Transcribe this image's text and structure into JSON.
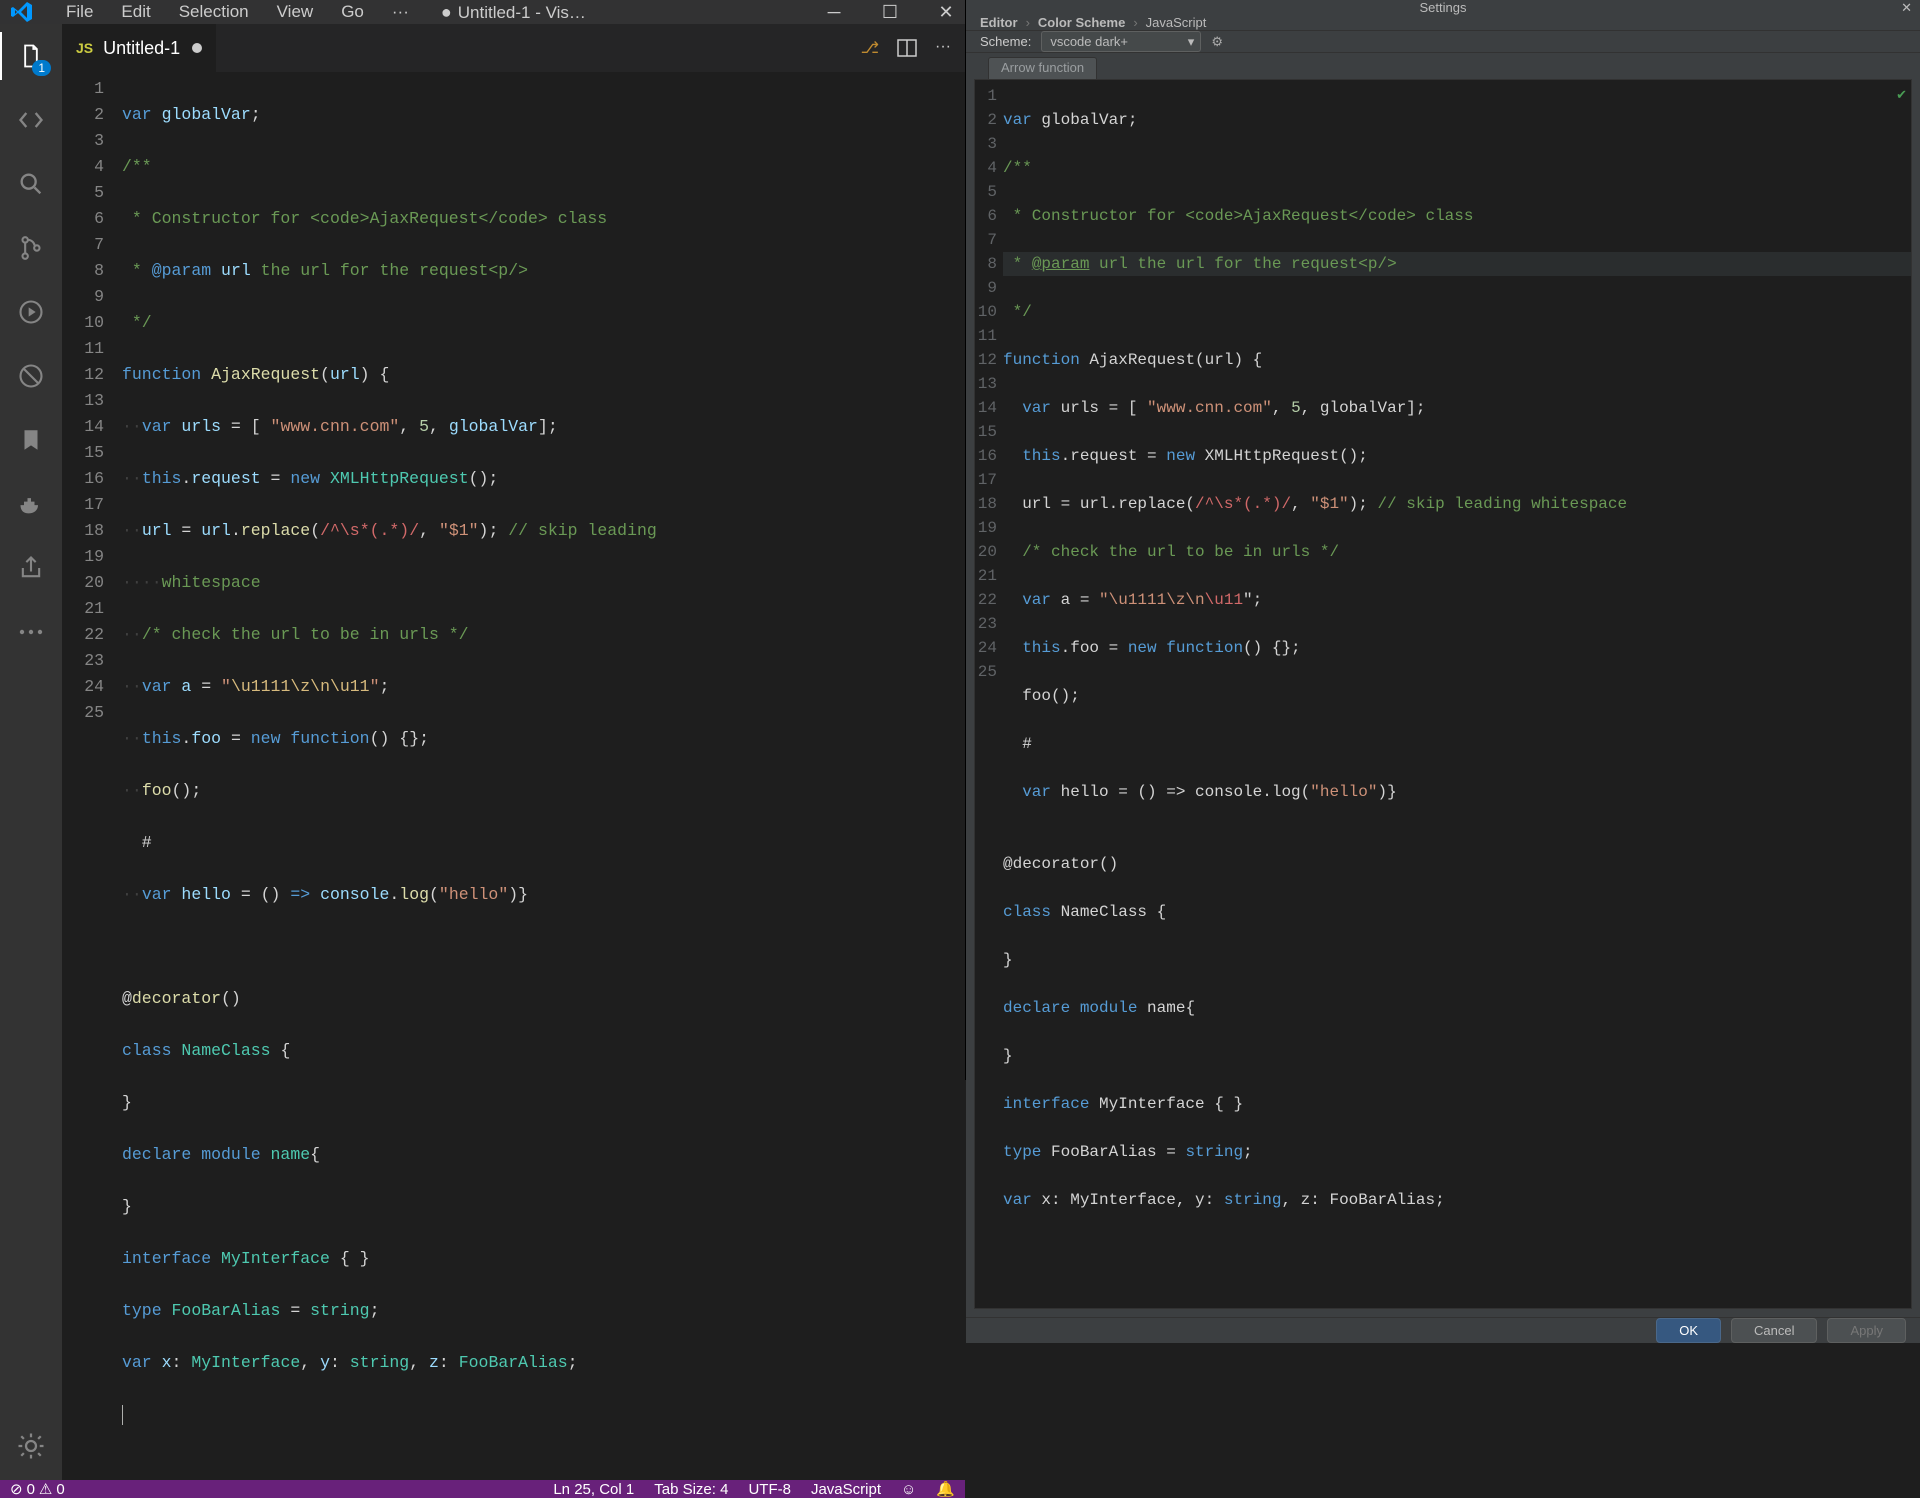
{
  "vscode": {
    "menus": [
      "File",
      "Edit",
      "Selection",
      "View",
      "Go",
      "···"
    ],
    "title_prefix": "●",
    "title": "Untitled-1 - Vis…",
    "tab": {
      "icon": "JS",
      "name": "Untitled-1"
    },
    "activity_badge": "1",
    "gutter": [
      "1",
      "2",
      "3",
      "4",
      "5",
      "6",
      "7",
      "8",
      "9",
      "10",
      "11",
      "12",
      "13",
      "14",
      "15",
      "16",
      "17",
      "18",
      "19",
      "20",
      "21",
      "22",
      "23",
      "24",
      "25"
    ],
    "status": {
      "errors": "0",
      "warnings": "0",
      "cursor": "Ln 25, Col 1",
      "tabsize": "Tab Size: 4",
      "encoding": "UTF-8",
      "language": "JavaScript"
    },
    "code": {
      "l1": {
        "a": "var ",
        "b": "globalVar",
        "c": ";"
      },
      "l2": "/**",
      "l3": {
        "a": " * Constructor for ",
        "b": "<code>",
        "c": "AjaxRequest",
        "d": "</code>",
        "e": " class"
      },
      "l4": {
        "a": " * ",
        "b": "@param",
        "c": " ",
        "d": "url",
        "e": " the url for the request<p/>"
      },
      "l5": " */",
      "l6": {
        "a": "function ",
        "b": "AjaxRequest",
        "c": "(",
        "d": "url",
        "e": ") {"
      },
      "l7": {
        "a": "  ",
        "b": "var ",
        "c": "urls",
        "d": " = [ ",
        "e": "\"www.cnn.com\"",
        "f": ", ",
        "g": "5",
        "h": ", ",
        "i": "globalVar",
        "j": "];"
      },
      "l8": {
        "a": "  ",
        "b": "this",
        "c": ".",
        "d": "request",
        "e": " = ",
        "f": "new ",
        "g": "XMLHttpRequest",
        "h": "();"
      },
      "l9": {
        "a": "  ",
        "b": "url",
        "c": " = ",
        "d": "url",
        "e": ".",
        "f": "replace",
        "g": "(",
        "h": "/^\\s*(.*)/",
        "i": ", ",
        "j": "\"$1\"",
        "k": "); ",
        "l": "// skip leading"
      },
      "l9b": {
        "a": "    ",
        "b": "whitespace"
      },
      "l10": {
        "a": "  ",
        "b": "/* check the url to be in urls */"
      },
      "l11": {
        "a": "  ",
        "b": "var ",
        "c": "a",
        "d": " = ",
        "e": "\"",
        "f": "\\u1111\\z\\n\\u11",
        "g": "\"",
        "h": ";"
      },
      "l12": {
        "a": "  ",
        "b": "this",
        "c": ".",
        "d": "foo",
        "e": " = ",
        "f": "new ",
        "g": "function",
        "h": "() {};"
      },
      "l13": {
        "a": "  ",
        "b": "foo",
        "c": "();"
      },
      "l14": {
        "a": "  #"
      },
      "l15": {
        "a": "  ",
        "b": "var ",
        "c": "hello",
        "d": " = () ",
        "e": "=>",
        "f": " ",
        "g": "console",
        "h": ".",
        "i": "log",
        "j": "(",
        "k": "\"hello\"",
        "l": ")}"
      },
      "l16": "",
      "l17": {
        "a": "@",
        "b": "decorator",
        "c": "()"
      },
      "l18": {
        "a": "class ",
        "b": "NameClass",
        "c": " {"
      },
      "l19": "}",
      "l20": {
        "a": "declare ",
        "b": "module ",
        "c": "name",
        "d": "{"
      },
      "l21": "}",
      "l22": {
        "a": "interface ",
        "b": "MyInterface",
        "c": " { }"
      },
      "l23": {
        "a": "type ",
        "b": "FooBarAlias",
        "c": " = ",
        "d": "string",
        "e": ";"
      },
      "l24": {
        "a": "var ",
        "b": "x",
        "c": ": ",
        "d": "MyInterface",
        "e": ", ",
        "f": "y",
        "g": ": ",
        "h": "string",
        "i": ", ",
        "j": "z",
        "k": ": ",
        "l": "FooBarAlias",
        "m": ";"
      }
    }
  },
  "jetbrains": {
    "title": "Settings",
    "breadcrumb": [
      "Editor",
      "Color Scheme",
      "JavaScript"
    ],
    "scheme_label": "Scheme:",
    "scheme_value": "vscode dark+",
    "tab": "Arrow function",
    "buttons": {
      "ok": "OK",
      "cancel": "Cancel",
      "apply": "Apply"
    },
    "gutter": [
      "1",
      "2",
      "3",
      "4",
      "5",
      "6",
      "7",
      "8",
      "9",
      "10",
      "11",
      "12",
      "13",
      "14",
      "15",
      "16",
      "17",
      "18",
      "19",
      "20",
      "21",
      "22",
      "23",
      "24",
      "25"
    ],
    "code": {
      "l1": {
        "a": "var ",
        "b": "globalVar",
        "c": ";"
      },
      "l2": "/**",
      "l3": " * Constructor for <code>AjaxRequest</code> class",
      "l4": {
        "a": " * ",
        "b": "@param",
        "c": " url the url for the request<p/>"
      },
      "l5": " */",
      "l6": {
        "a": "function ",
        "b": "AjaxRequest",
        "c": "(url) {"
      },
      "l7": {
        "a": "  ",
        "b": "var ",
        "c": "urls = [ ",
        "d": "\"www.cnn.com\"",
        "e": ", ",
        "f": "5",
        "g": ", globalVar];"
      },
      "l8": {
        "a": "  ",
        "b": "this",
        "c": ".request = ",
        "d": "new ",
        "e": "XMLHttpRequest();"
      },
      "l9": {
        "a": "  url = url.replace(",
        "b": "/^\\s*(.*)/",
        "c": ", ",
        "d": "\"$1\"",
        "e": "); ",
        "f": "// skip leading whitespace"
      },
      "l10": {
        "a": "  ",
        "b": "/* check the url to be in urls */"
      },
      "l11": {
        "a": "  ",
        "b": "var ",
        "c": "a = ",
        "d": "\"\\u1111\\z\\n",
        "e": "\\u11",
        "f": "\";"
      },
      "l12": {
        "a": "  ",
        "b": "this",
        "c": ".foo = ",
        "d": "new ",
        "e": "function",
        "f": "() {};"
      },
      "l13": "  foo();",
      "l14": "  #",
      "l15": {
        "a": "  ",
        "b": "var ",
        "c": "hello = () => console.log(",
        "d": "\"hello\"",
        "e": ")}"
      },
      "l16": "",
      "l17": "@decorator()",
      "l18": {
        "a": "class ",
        "b": "NameClass ",
        "c": "{"
      },
      "l19": "}",
      "l20": {
        "a": "declare ",
        "b": "module ",
        "c": "name{"
      },
      "l21": "}",
      "l22": {
        "a": "interface ",
        "b": "MyInterface { }"
      },
      "l23": {
        "a": "type ",
        "b": "FooBarAlias = ",
        "c": "string",
        "d": ";"
      },
      "l24": {
        "a": "var ",
        "b": "x: MyInterface, y: ",
        "c": "string",
        "d": ", z: FooBarAlias;"
      }
    }
  }
}
